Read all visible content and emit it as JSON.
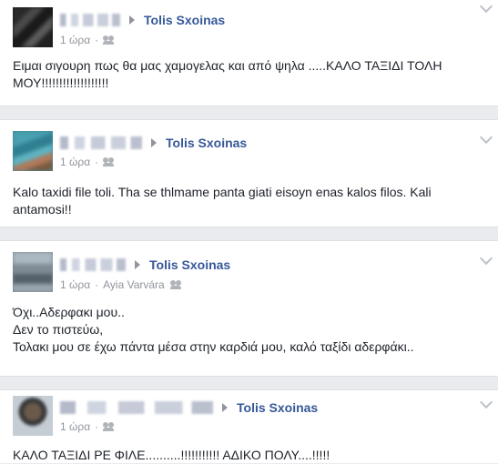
{
  "posts": [
    {
      "target_name": "Tolis Sxoinas",
      "time": "1 ώρα",
      "location": "",
      "lines": [
        "Ειμαι σιγουρη πως θα μας χαμογελας και από ψηλα .....ΚΑΛΟ ΤΑΞΙΔΙ ΤΟΛΗ ΜΟΥ!!!!!!!!!!!!!!!!!!!"
      ]
    },
    {
      "target_name": "Tolis Sxoinas",
      "time": "1 ώρα",
      "location": "",
      "lines": [
        "Kalo taxidi file toli. Tha se thlmame panta giati eisoyn enas kalos filos. Kali antamosi!!"
      ]
    },
    {
      "target_name": "Tolis Sxoinas",
      "time": "1 ώρα",
      "location": "Ayia Varvára",
      "lines": [
        "Όχι..Αδερφακι μου..",
        "Δεν το πιστεύω,",
        "Τολακι μου σε έχω πάντα μέσα στην καρδιά μου, καλό ταξίδι αδερφάκι.."
      ]
    },
    {
      "target_name": "Tolis Sxoinas",
      "time": "1 ώρα",
      "location": "",
      "lines": [
        "ΚΑΛΟ ΤΑΞΙΔΙ ΡΕ ΦΙΛΕ..........!!!!!!!!!!! ΑΔΙΚΟ ΠΟΛΥ....!!!!!"
      ]
    }
  ],
  "meta_separator": "·",
  "icons": {
    "share_arrow": "right-triangle",
    "audience": "friends-icon",
    "menu": "chevron-down-icon"
  },
  "colors": {
    "name_link": "#365899",
    "meta_text": "#90949c",
    "body_text": "#1d2129",
    "feed_background": "#e9ebee"
  }
}
